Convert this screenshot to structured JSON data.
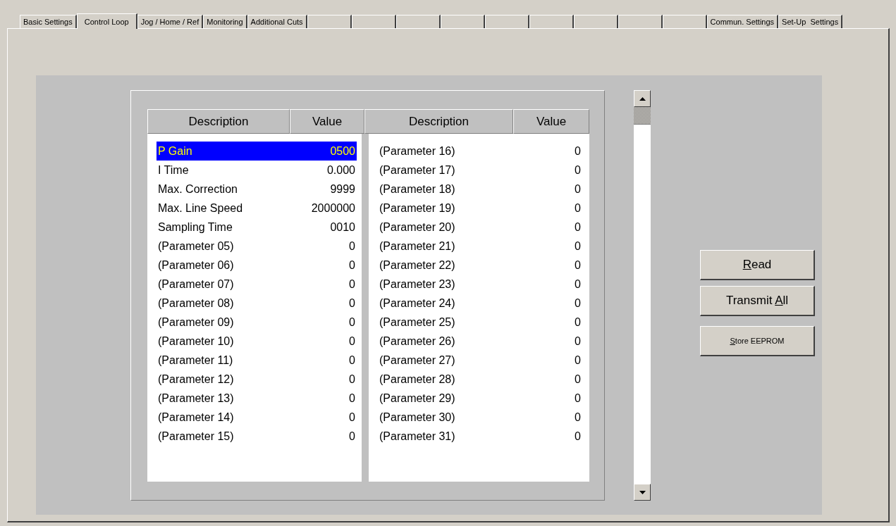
{
  "tabs": [
    {
      "kind": "label",
      "label": "Basic Settings",
      "selected": false
    },
    {
      "kind": "label",
      "label": "Control Loop",
      "selected": true
    },
    {
      "kind": "label",
      "label": "Jog / Home / Ref",
      "selected": false
    },
    {
      "kind": "label",
      "label": "Monitoring",
      "selected": false
    },
    {
      "kind": "label",
      "label": "Additional Cuts",
      "selected": false
    },
    {
      "kind": "blank",
      "selected": false
    },
    {
      "kind": "blank",
      "selected": false
    },
    {
      "kind": "blank",
      "selected": false
    },
    {
      "kind": "blank",
      "selected": false
    },
    {
      "kind": "blank",
      "selected": false
    },
    {
      "kind": "blank",
      "selected": false
    },
    {
      "kind": "blank",
      "selected": false
    },
    {
      "kind": "blank",
      "selected": false
    },
    {
      "kind": "blank",
      "selected": false
    },
    {
      "kind": "label",
      "label": "Commun. Settings",
      "selected": false
    },
    {
      "kind": "label",
      "label": "Set-Up  Settings",
      "selected": false
    }
  ],
  "table": {
    "columns": [
      "Description",
      "Value",
      "Description",
      "Value"
    ],
    "left_rows": [
      {
        "description": "P Gain",
        "value": "0500",
        "selected": true
      },
      {
        "description": "I Time",
        "value": "0.000",
        "selected": false
      },
      {
        "description": "Max. Correction",
        "value": "9999",
        "selected": false
      },
      {
        "description": "Max. Line Speed",
        "value": "2000000",
        "selected": false
      },
      {
        "description": "Sampling Time",
        "value": "0010",
        "selected": false
      },
      {
        "description": "(Parameter 05)",
        "value": "0",
        "selected": false
      },
      {
        "description": "(Parameter 06)",
        "value": "0",
        "selected": false
      },
      {
        "description": "(Parameter 07)",
        "value": "0",
        "selected": false
      },
      {
        "description": "(Parameter 08)",
        "value": "0",
        "selected": false
      },
      {
        "description": "(Parameter 09)",
        "value": "0",
        "selected": false
      },
      {
        "description": "(Parameter 10)",
        "value": "0",
        "selected": false
      },
      {
        "description": "(Parameter 11)",
        "value": "0",
        "selected": false
      },
      {
        "description": "(Parameter 12)",
        "value": "0",
        "selected": false
      },
      {
        "description": "(Parameter 13)",
        "value": "0",
        "selected": false
      },
      {
        "description": "(Parameter 14)",
        "value": "0",
        "selected": false
      },
      {
        "description": "(Parameter 15)",
        "value": "0",
        "selected": false
      }
    ],
    "right_rows": [
      {
        "description": "(Parameter 16)",
        "value": "0",
        "selected": false
      },
      {
        "description": "(Parameter 17)",
        "value": "0",
        "selected": false
      },
      {
        "description": "(Parameter 18)",
        "value": "0",
        "selected": false
      },
      {
        "description": "(Parameter 19)",
        "value": "0",
        "selected": false
      },
      {
        "description": "(Parameter 20)",
        "value": "0",
        "selected": false
      },
      {
        "description": "(Parameter 21)",
        "value": "0",
        "selected": false
      },
      {
        "description": "(Parameter 22)",
        "value": "0",
        "selected": false
      },
      {
        "description": "(Parameter 23)",
        "value": "0",
        "selected": false
      },
      {
        "description": "(Parameter 24)",
        "value": "0",
        "selected": false
      },
      {
        "description": "(Parameter 25)",
        "value": "0",
        "selected": false
      },
      {
        "description": "(Parameter 26)",
        "value": "0",
        "selected": false
      },
      {
        "description": "(Parameter 27)",
        "value": "0",
        "selected": false
      },
      {
        "description": "(Parameter 28)",
        "value": "0",
        "selected": false
      },
      {
        "description": "(Parameter 29)",
        "value": "0",
        "selected": false
      },
      {
        "description": "(Parameter 30)",
        "value": "0",
        "selected": false
      },
      {
        "description": "(Parameter 31)",
        "value": "0",
        "selected": false
      }
    ]
  },
  "buttons": [
    {
      "kind": "large",
      "label_parts": [
        {
          "text": "R",
          "underlined": true
        },
        {
          "text": "ead",
          "underlined": false
        }
      ]
    },
    {
      "kind": "large",
      "label_parts": [
        {
          "text": "Transmit ",
          "underlined": false
        },
        {
          "text": "A",
          "underlined": true
        },
        {
          "text": "ll",
          "underlined": false
        }
      ]
    },
    {
      "kind": "small",
      "label_parts": [
        {
          "text": "S",
          "underlined": true
        },
        {
          "text": "tore EEPROM",
          "underlined": false
        }
      ]
    }
  ]
}
